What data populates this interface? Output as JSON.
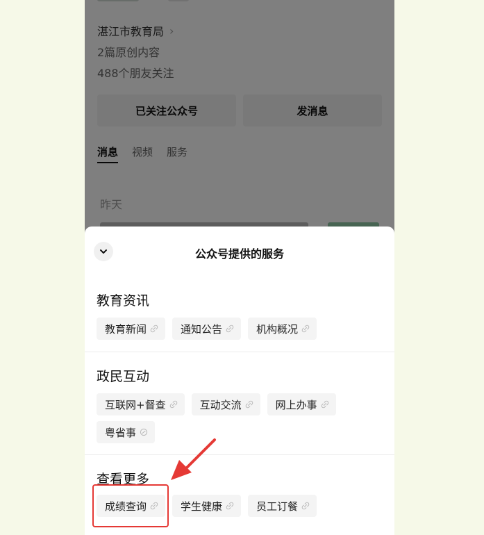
{
  "profile": {
    "account_name": "湛江市教育局",
    "articles": "2篇原创内容",
    "followers": "488个朋友关注",
    "followed_button": "已关注公众号",
    "message_button": "发消息",
    "tabs": [
      {
        "label": "消息"
      },
      {
        "label": "视频"
      },
      {
        "label": "服务"
      }
    ],
    "date_label": "昨天"
  },
  "sheet": {
    "title": "公众号提供的服务",
    "sections": [
      {
        "title": "教育资讯",
        "chips": [
          {
            "label": "教育新闻"
          },
          {
            "label": "通知公告"
          },
          {
            "label": "机构概况"
          }
        ]
      },
      {
        "title": "政民互动",
        "chips": [
          {
            "label": "互联网+督查"
          },
          {
            "label": "互动交流"
          },
          {
            "label": "网上办事"
          },
          {
            "label": "粤省事"
          }
        ]
      },
      {
        "title": "查看更多",
        "chips": [
          {
            "label": "成绩查询"
          },
          {
            "label": "学生健康"
          },
          {
            "label": "员工订餐"
          }
        ]
      }
    ]
  },
  "colors": {
    "page_bg": "#f6f9e8",
    "annotation_red": "#e53935",
    "chip_bg": "#f4f4f4"
  }
}
